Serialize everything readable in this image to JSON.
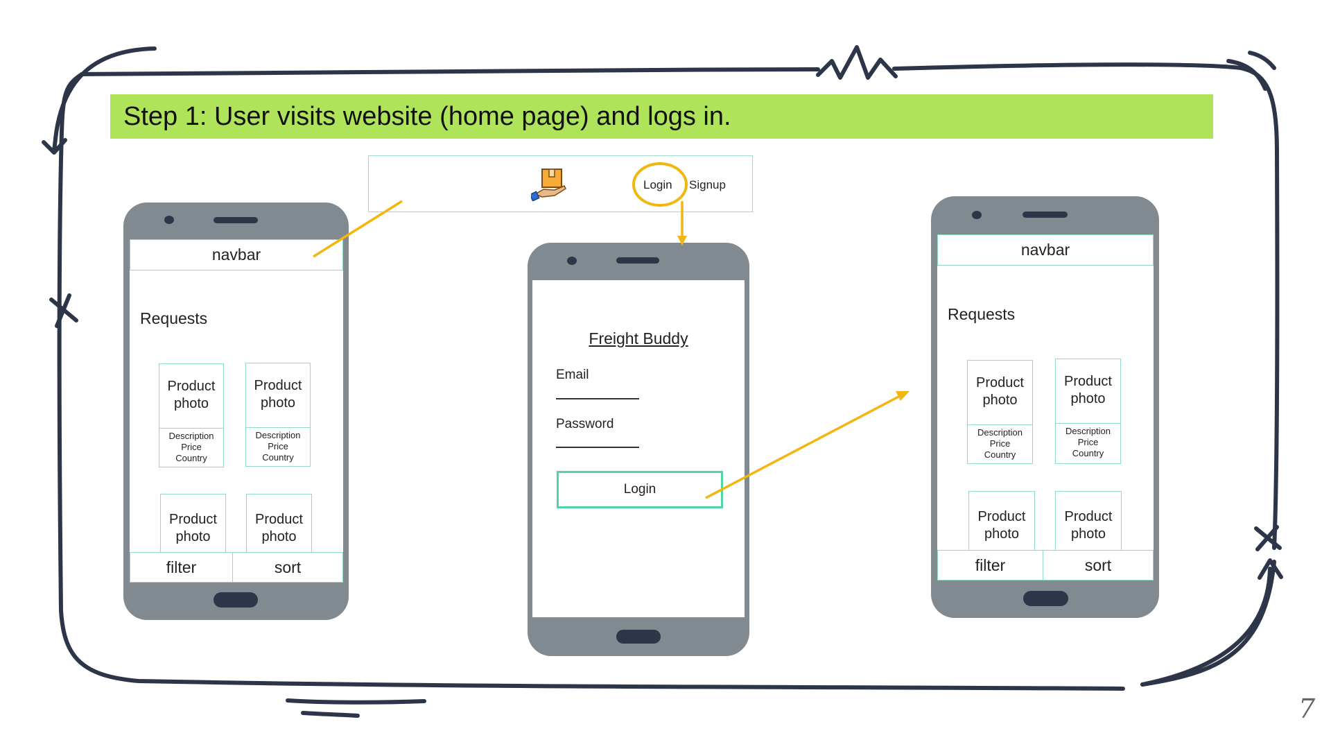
{
  "title": "Step 1: User visits website (home page) and logs in.",
  "website_navbar": {
    "login": "Login",
    "signup": "Signup",
    "logo_icon": "delivery-box-hand-icon"
  },
  "home_phone": {
    "navbar": "navbar",
    "heading": "Requests",
    "card_top": "Product photo",
    "card_lines": [
      "Description",
      "Price",
      "Country"
    ],
    "filter": "filter",
    "sort": "sort"
  },
  "login_phone": {
    "app_name": "Freight Buddy",
    "email_label": "Email",
    "password_label": "Password",
    "login_button": "Login"
  },
  "page_number": "7",
  "colors": {
    "title_bg": "#aee35a",
    "arrow": "#f2b60f",
    "wire_border": "#8fdcc2",
    "phone_body": "#808a90",
    "frame_ink": "#2c3648"
  }
}
